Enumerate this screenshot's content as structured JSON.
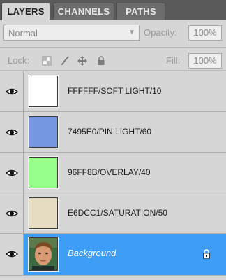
{
  "tabs": [
    {
      "label": "LAYERS",
      "active": true
    },
    {
      "label": "CHANNELS",
      "active": false
    },
    {
      "label": "PATHS",
      "active": false
    }
  ],
  "blend_mode": {
    "value": "Normal"
  },
  "opacity": {
    "label": "Opacity:",
    "value": "100%"
  },
  "lock": {
    "label": "Lock:",
    "icons": [
      "lock-transparent-icon",
      "lock-brush-icon",
      "lock-move-icon",
      "lock-all-icon"
    ]
  },
  "fill": {
    "label": "Fill:",
    "value": "100%"
  },
  "layers": [
    {
      "name": "FFFFFF/SOFT LIGHT/10",
      "thumb_color": "#FFFFFF",
      "visible": true
    },
    {
      "name": "7495E0/PIN LIGHT/60",
      "thumb_color": "#7495E0",
      "visible": true
    },
    {
      "name": "96FF8B/OVERLAY/40",
      "thumb_color": "#96FF8B",
      "visible": true
    },
    {
      "name": "E6DCC1/SATURATION/50",
      "thumb_color": "#E6DCC1",
      "visible": true
    },
    {
      "name": "Background",
      "thumb": "face-photo",
      "visible": true,
      "locked": true,
      "selected": true
    }
  ],
  "colors": {
    "selection": "#3E9DF4",
    "panel": "#D6D6D6",
    "tabbar": "#5A5A5A"
  }
}
